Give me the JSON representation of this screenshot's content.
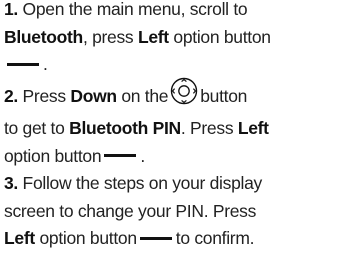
{
  "steps": [
    {
      "num": "1.",
      "t1": " Open the main menu, scroll to",
      "b1": "Bluetooth",
      "t2": ", press ",
      "b2": "Left",
      "t3": " option button",
      "t4": "."
    },
    {
      "num": "2.",
      "t1": " Press ",
      "b1": "Down",
      "t2": " on the",
      "t3": "button",
      "t4": "to get to ",
      "b2": "Bluetooth PIN",
      "t5": ". Press ",
      "b3": "Left",
      "t6": "option button",
      "t7": "."
    },
    {
      "num": "3.",
      "t1": " Follow the steps on your display",
      "t2": "screen to change your PIN. Press",
      "b1": "Left",
      "t3": " option button",
      "t4": "to confirm."
    }
  ],
  "icons": {
    "option_button": "horizontal-dash-icon",
    "nav_button": "five-way-navigation-icon"
  }
}
